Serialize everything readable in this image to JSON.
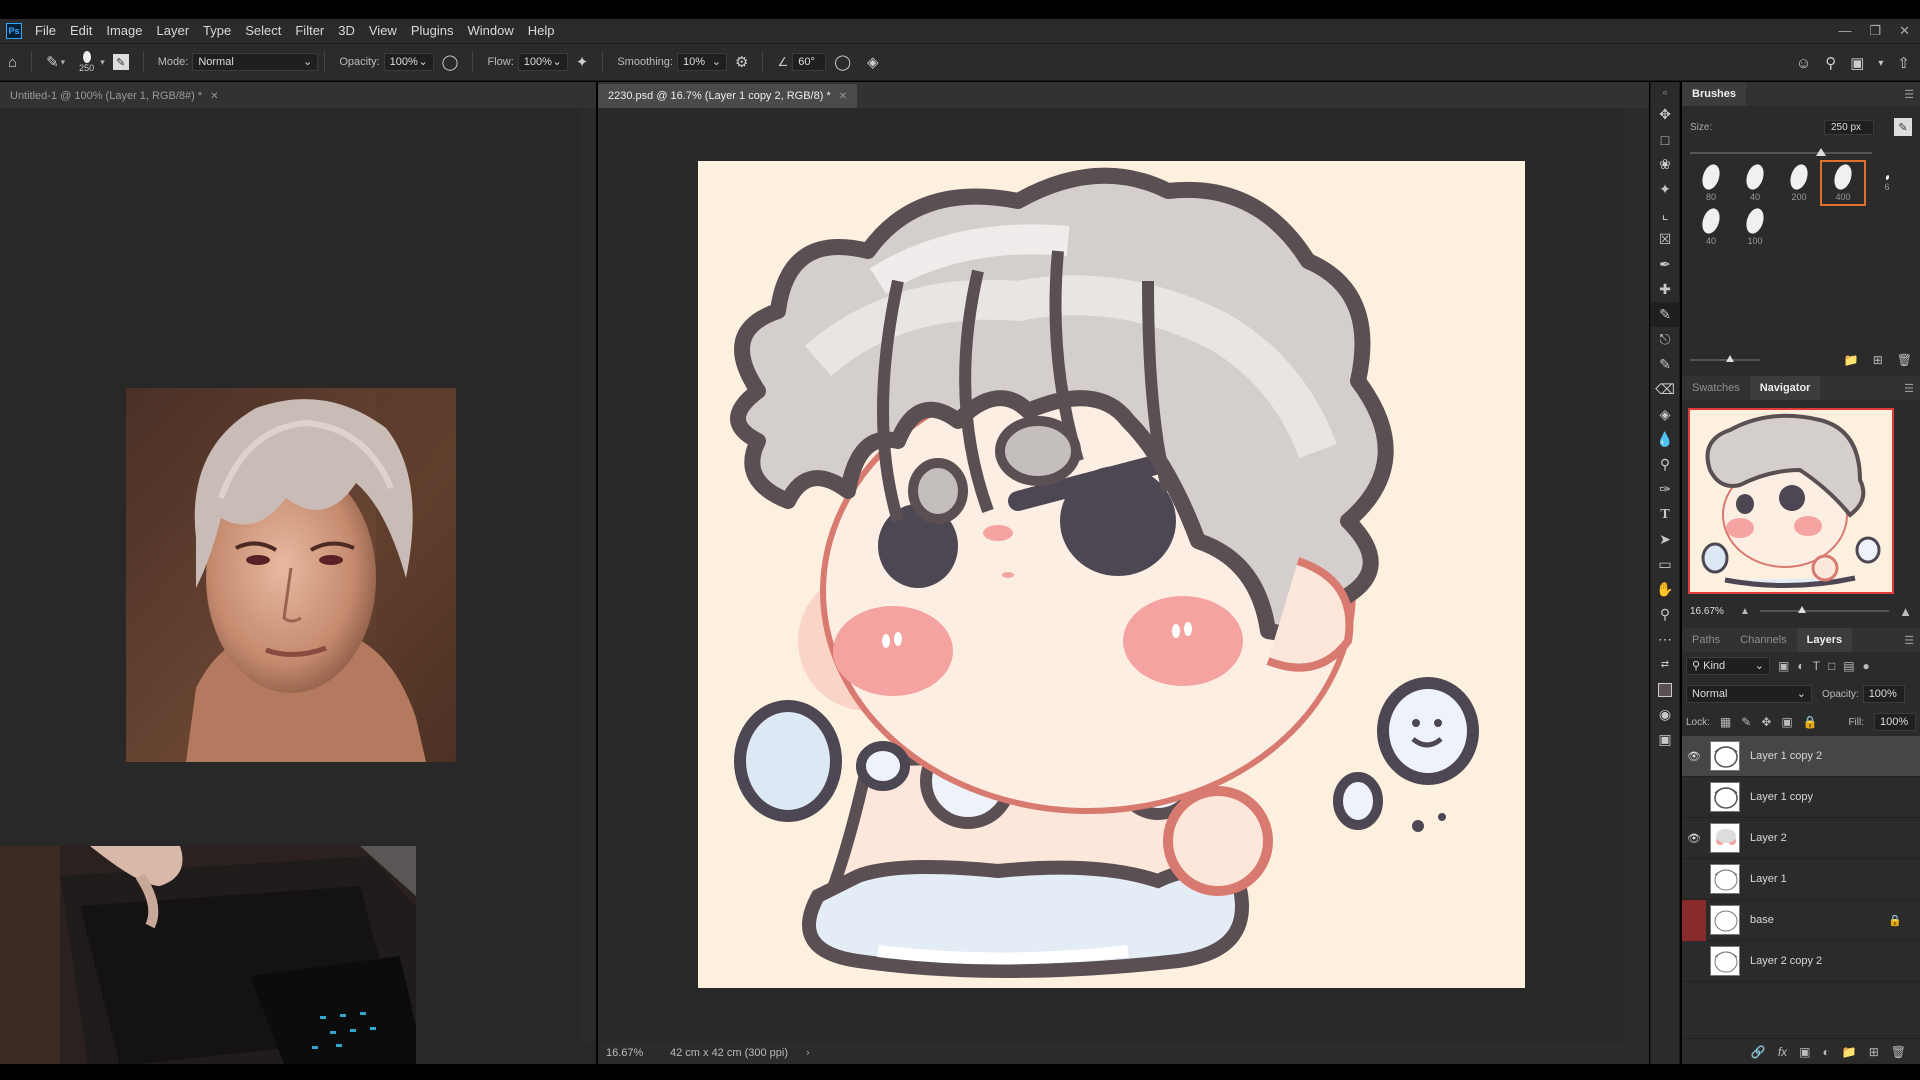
{
  "menu": {
    "logo": "Ps",
    "items": [
      "File",
      "Edit",
      "Image",
      "Layer",
      "Type",
      "Select",
      "Filter",
      "3D",
      "View",
      "Plugins",
      "Window",
      "Help"
    ]
  },
  "options": {
    "brush_size": "250",
    "mode_label": "Mode:",
    "mode_value": "Normal",
    "opacity_label": "Opacity:",
    "opacity_value": "100%",
    "flow_label": "Flow:",
    "flow_value": "100%",
    "smoothing_label": "Smoothing:",
    "smoothing_value": "10%",
    "angle_value": "60°"
  },
  "documents": {
    "tab1": "Untitled-1 @ 100% (Layer 1, RGB/8#) *",
    "tab2": "2230.psd @ 16.7% (Layer 1 copy 2, RGB/8) *",
    "status_zoom": "16.67%",
    "status_info": "42 cm x 42 cm (300 ppi)"
  },
  "brushes_panel": {
    "title": "Brushes",
    "size_label": "Size:",
    "size_value": "250 px",
    "presets": [
      "80",
      "40",
      "200",
      "400",
      "6",
      "40",
      "100"
    ],
    "selected_index": 3
  },
  "nav_panel": {
    "tabs": [
      "Swatches",
      "Navigator"
    ],
    "active": "Navigator",
    "zoom": "16.67%"
  },
  "layers_panel": {
    "tabs": [
      "Paths",
      "Channels",
      "Layers"
    ],
    "active": "Layers",
    "kind_label": "Kind",
    "blend_mode": "Normal",
    "opacity_label": "Opacity:",
    "opacity_value": "100%",
    "lock_label": "Lock:",
    "fill_label": "Fill:",
    "fill_value": "100%",
    "layers": [
      {
        "name": "Layer 1 copy 2",
        "visible": true,
        "selected": true
      },
      {
        "name": "Layer 1 copy",
        "visible": false,
        "selected": false
      },
      {
        "name": "Layer 2",
        "visible": true,
        "selected": false
      },
      {
        "name": "Layer 1",
        "visible": false,
        "selected": false
      },
      {
        "name": "base",
        "visible": false,
        "selected": false,
        "locked": true
      },
      {
        "name": "Layer 2 copy 2",
        "visible": false,
        "selected": false
      }
    ]
  },
  "colors": {
    "accent": "#e07030",
    "canvas_bg": "#fdf0df",
    "outline": "#5a4f52"
  }
}
